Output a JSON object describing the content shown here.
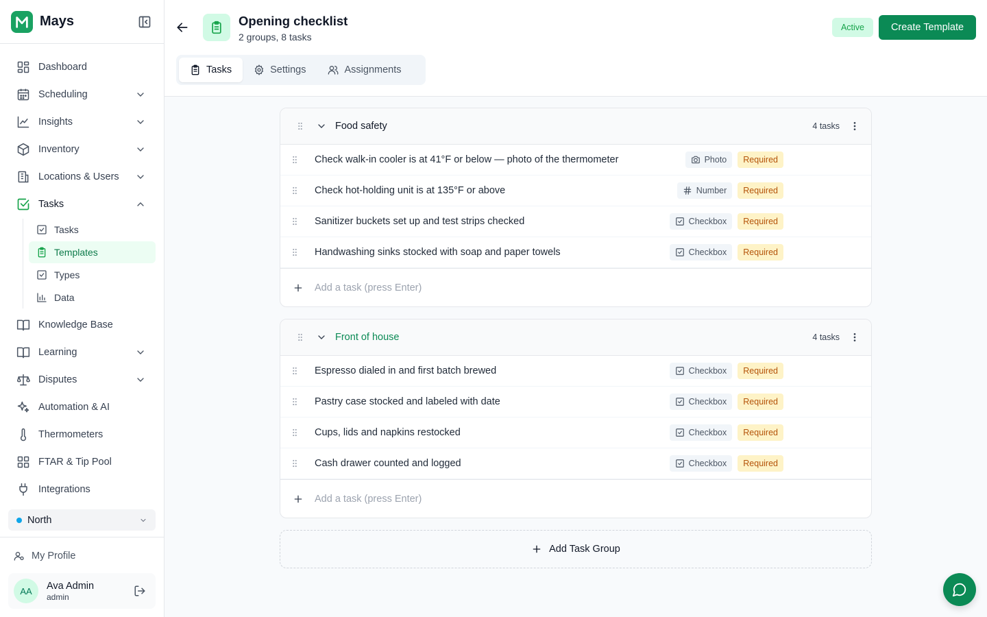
{
  "brand": {
    "name": "Mays",
    "color": "#1aa262"
  },
  "sidebar": {
    "items": [
      {
        "label": "Dashboard",
        "icon": "dashboard-icon"
      },
      {
        "label": "Scheduling",
        "icon": "calendar-icon",
        "expandable": true
      },
      {
        "label": "Insights",
        "icon": "chart-line-icon",
        "expandable": true
      },
      {
        "label": "Inventory",
        "icon": "box-icon",
        "expandable": true
      },
      {
        "label": "Locations & Users",
        "icon": "building-icon",
        "expandable": true
      },
      {
        "label": "Tasks",
        "icon": "check-square-icon",
        "expanded": true,
        "active": true
      },
      {
        "label": "Knowledge Base",
        "icon": "book-icon"
      },
      {
        "label": "Learning",
        "icon": "book-icon",
        "expandable": true
      },
      {
        "label": "Disputes",
        "icon": "scale-icon",
        "expandable": true
      },
      {
        "label": "Automation & AI",
        "icon": "sparkles-icon"
      },
      {
        "label": "Thermometers",
        "icon": "thermometer-icon"
      },
      {
        "label": "FTAR & Tip Pool",
        "icon": "grid-icon"
      },
      {
        "label": "Integrations",
        "icon": "plug-icon"
      }
    ],
    "task_subitems": [
      {
        "label": "Tasks",
        "icon": "check-square-icon"
      },
      {
        "label": "Templates",
        "icon": "clipboard-icon",
        "active": true
      },
      {
        "label": "Types",
        "icon": "check-square-icon"
      },
      {
        "label": "Data",
        "icon": "bar-chart-icon"
      }
    ],
    "location": "North",
    "profile_link": "My Profile",
    "user": {
      "initials": "AA",
      "name": "Ava Admin",
      "role": "admin"
    }
  },
  "header": {
    "title": "Opening checklist",
    "subtitle": "2 groups, 8 tasks",
    "status": "Active",
    "create_button": "Create Template",
    "tabs": [
      {
        "label": "Tasks",
        "icon": "clipboard-icon",
        "active": true
      },
      {
        "label": "Settings",
        "icon": "gear-icon"
      },
      {
        "label": "Assignments",
        "icon": "users-icon"
      }
    ]
  },
  "groups": [
    {
      "name": "Food safety",
      "count": "4 tasks",
      "tasks": [
        {
          "text": "Check walk-in cooler is at 41°F or below — photo of the thermometer",
          "type": "Photo",
          "required": "Required"
        },
        {
          "text": "Check hot-holding unit is at 135°F or above",
          "type": "Number",
          "required": "Required"
        },
        {
          "text": "Sanitizer buckets set up and test strips checked",
          "type": "Checkbox",
          "required": "Required"
        },
        {
          "text": "Handwashing sinks stocked with soap and paper towels",
          "type": "Checkbox",
          "required": "Required"
        }
      ],
      "add_placeholder": "Add a task (press Enter)"
    },
    {
      "name": "Front of house",
      "count": "4 tasks",
      "tasks": [
        {
          "text": "Espresso dialed in and first batch brewed",
          "type": "Checkbox",
          "required": "Required"
        },
        {
          "text": "Pastry case stocked and labeled with date",
          "type": "Checkbox",
          "required": "Required"
        },
        {
          "text": "Cups, lids and napkins restocked",
          "type": "Checkbox",
          "required": "Required"
        },
        {
          "text": "Cash drawer counted and logged",
          "type": "Checkbox",
          "required": "Required"
        }
      ],
      "add_placeholder": "Add a task (press Enter)"
    }
  ],
  "add_group_label": "Add Task Group",
  "colors": {
    "primary": "#0b8a55",
    "required_bg": "#fef3c7",
    "required_text": "#b45309",
    "active_bg": "#d1fae5"
  }
}
